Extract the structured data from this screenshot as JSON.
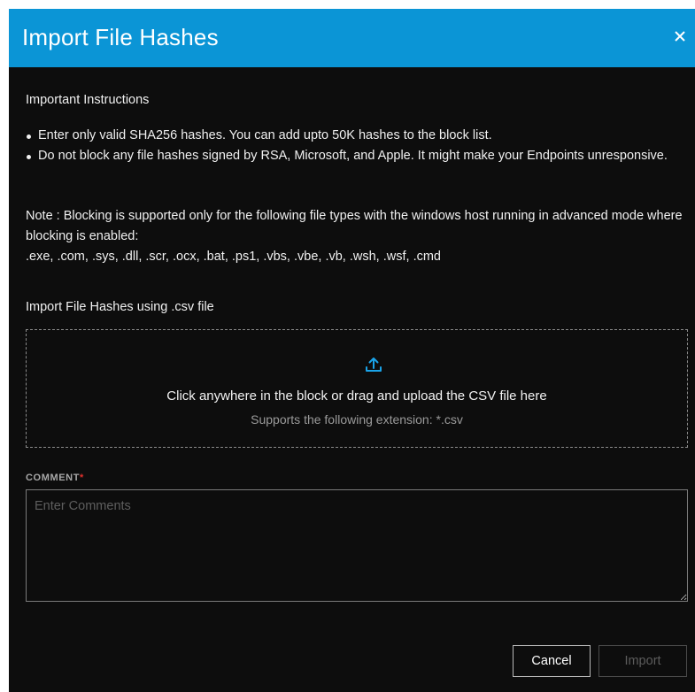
{
  "dialog": {
    "title": "Import File Hashes",
    "instructions_heading": "Important Instructions",
    "instructions": [
      "Enter only valid SHA256 hashes. You can add upto 50K hashes to the block list.",
      "Do not block any file hashes signed by RSA, Microsoft, and Apple. It might make your Endpoints unresponsive."
    ],
    "note": "Note : Blocking is supported only for the following file types with the windows host running in advanced mode where blocking is enabled:",
    "extensions": ".exe, .com, .sys, .dll, .scr, .ocx, .bat, .ps1, .vbs, .vbe, .vb, .wsh, .wsf, .cmd",
    "import_label": "Import File Hashes using .csv file",
    "dropzone": {
      "main_text": "Click anywhere in the block or drag and upload the CSV file here",
      "sub_text": "Supports the following extension: *.csv"
    },
    "comment": {
      "label": "COMMENT",
      "required_mark": "*",
      "placeholder": "Enter Comments",
      "value": ""
    },
    "buttons": {
      "cancel": "Cancel",
      "import": "Import"
    }
  },
  "colors": {
    "titlebar": "#0b95d6",
    "background": "#0d0d0d",
    "accent": "#1aa3e8",
    "required": "#e0302c"
  }
}
